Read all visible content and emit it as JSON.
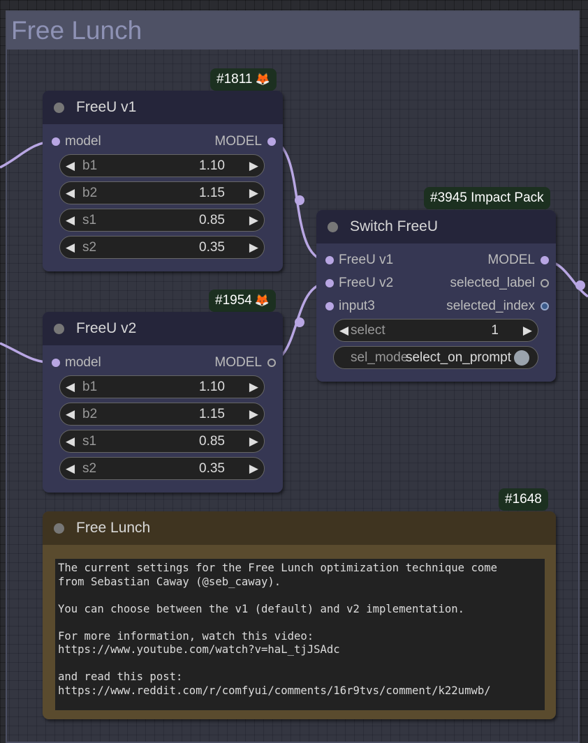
{
  "group": {
    "title": "Free Lunch"
  },
  "nodes": {
    "freeu_v1": {
      "id_badge": "#1811",
      "badge_icon": "fox-icon",
      "title": "FreeU v1",
      "input_label": "model",
      "output_label": "MODEL",
      "widgets": [
        {
          "label": "b1",
          "value": "1.10"
        },
        {
          "label": "b2",
          "value": "1.15"
        },
        {
          "label": "s1",
          "value": "0.85"
        },
        {
          "label": "s2",
          "value": "0.35"
        }
      ]
    },
    "freeu_v2": {
      "id_badge": "#1954",
      "badge_icon": "fox-icon",
      "title": "FreeU v2",
      "input_label": "model",
      "output_label": "MODEL",
      "widgets": [
        {
          "label": "b1",
          "value": "1.10"
        },
        {
          "label": "b2",
          "value": "1.15"
        },
        {
          "label": "s1",
          "value": "0.85"
        },
        {
          "label": "s2",
          "value": "0.35"
        }
      ]
    },
    "switch": {
      "id_badge": "#3945 Impact Pack",
      "title": "Switch FreeU",
      "inputs": [
        "FreeU v1",
        "FreeU v2",
        "input3"
      ],
      "outputs": [
        "MODEL",
        "selected_label",
        "selected_index"
      ],
      "select": {
        "label": "select",
        "value": "1"
      },
      "sel_mode": {
        "label": "sel_mode",
        "value": "select_on_prompt",
        "on": true
      }
    },
    "note": {
      "id_badge": "#1648",
      "title": "Free Lunch",
      "text": "The current settings for the Free Lunch optimization technique come\nfrom Sebastian Caway (@seb_caway).\n\nYou can choose between the v1 (default) and v2 implementation.\n\nFor more information, watch this video:\nhttps://www.youtube.com/watch?v=haL_tjJSAdc\n\nand read this post:\nhttps://www.reddit.com/r/comfyui/comments/16r9tvs/comment/k22umwb/"
    }
  },
  "colors": {
    "canvas": "#2a2b30",
    "group_header": "#4e5165",
    "node_body": "#363753",
    "node_title": "#25253a",
    "model_link": "#b8a6e3",
    "badge": "#1c3020",
    "note_body": "#5a4b2e"
  }
}
